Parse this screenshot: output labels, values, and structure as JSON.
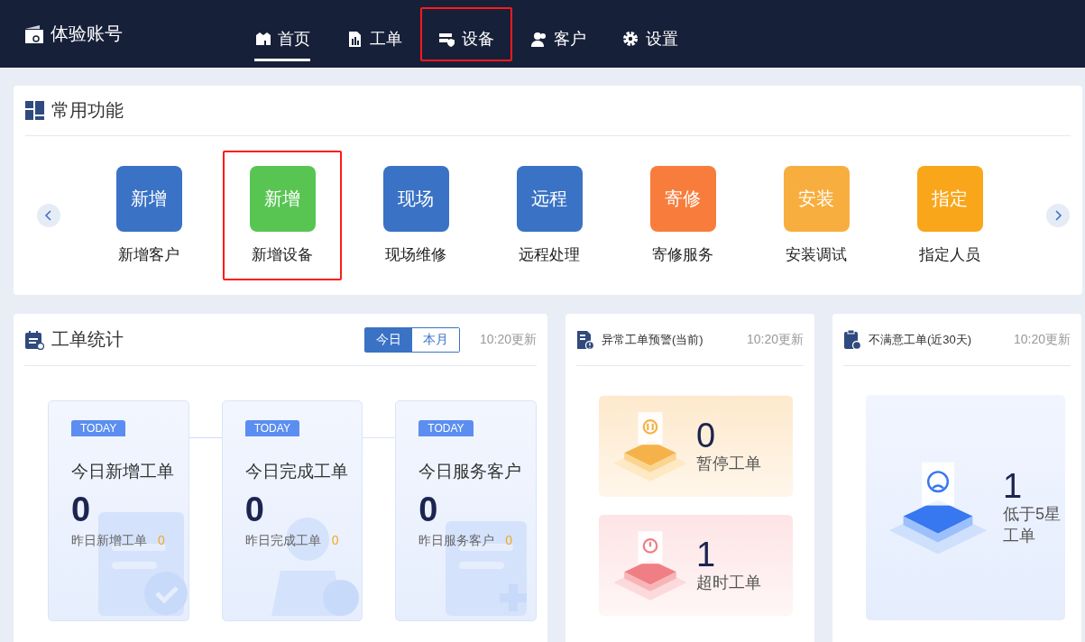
{
  "header": {
    "account": "体验账号",
    "nav": [
      {
        "label": "首页",
        "selected": true,
        "highlighted": false
      },
      {
        "label": "工单",
        "selected": false,
        "highlighted": false
      },
      {
        "label": "设备",
        "selected": false,
        "highlighted": true
      },
      {
        "label": "客户",
        "selected": false,
        "highlighted": false
      },
      {
        "label": "设置",
        "selected": false,
        "highlighted": false
      }
    ]
  },
  "quick_functions": {
    "title": "常用功能",
    "items": [
      {
        "tile": "新增",
        "label": "新增客户",
        "color": "#3a72c5",
        "highlighted": false
      },
      {
        "tile": "新增",
        "label": "新增设备",
        "color": "#58c553",
        "highlighted": true
      },
      {
        "tile": "现场",
        "label": "现场维修",
        "color": "#3a72c5",
        "highlighted": false
      },
      {
        "tile": "远程",
        "label": "远程处理",
        "color": "#3a72c5",
        "highlighted": false
      },
      {
        "tile": "寄修",
        "label": "寄修服务",
        "color": "#f87d3c",
        "highlighted": false
      },
      {
        "tile": "安装",
        "label": "安装调试",
        "color": "#f8ae3f",
        "highlighted": false
      },
      {
        "tile": "指定",
        "label": "指定人员",
        "color": "#f9a61a",
        "highlighted": false
      }
    ]
  },
  "work_order_stats": {
    "title": "工单统计",
    "tabs": [
      {
        "label": "今日",
        "selected": true
      },
      {
        "label": "本月",
        "selected": false
      }
    ],
    "updated": "10:20更新",
    "cards": [
      {
        "badge": "TODAY",
        "title": "今日新增工单",
        "value": "0",
        "sub_label": "昨日新增工单",
        "sub_value": "0",
        "kind": "doc"
      },
      {
        "badge": "TODAY",
        "title": "今日完成工单",
        "value": "0",
        "sub_label": "昨日完成工单",
        "sub_value": "0",
        "kind": "person"
      },
      {
        "badge": "TODAY",
        "title": "今日服务客户",
        "value": "0",
        "sub_label": "昨日服务客户",
        "sub_value": "0",
        "kind": "add"
      }
    ]
  },
  "abnormal_alerts": {
    "title": "异常工单预警(当前)",
    "updated": "10:20更新",
    "items": [
      {
        "value": "0",
        "label": "暂停工单",
        "kind": "pause"
      },
      {
        "value": "1",
        "label": "超时工单",
        "kind": "timeout"
      }
    ]
  },
  "unsatisfied": {
    "title": "不满意工单(近30天)",
    "updated": "10:20更新",
    "value": "1",
    "label_lines": [
      "低于5星",
      "工单"
    ]
  }
}
